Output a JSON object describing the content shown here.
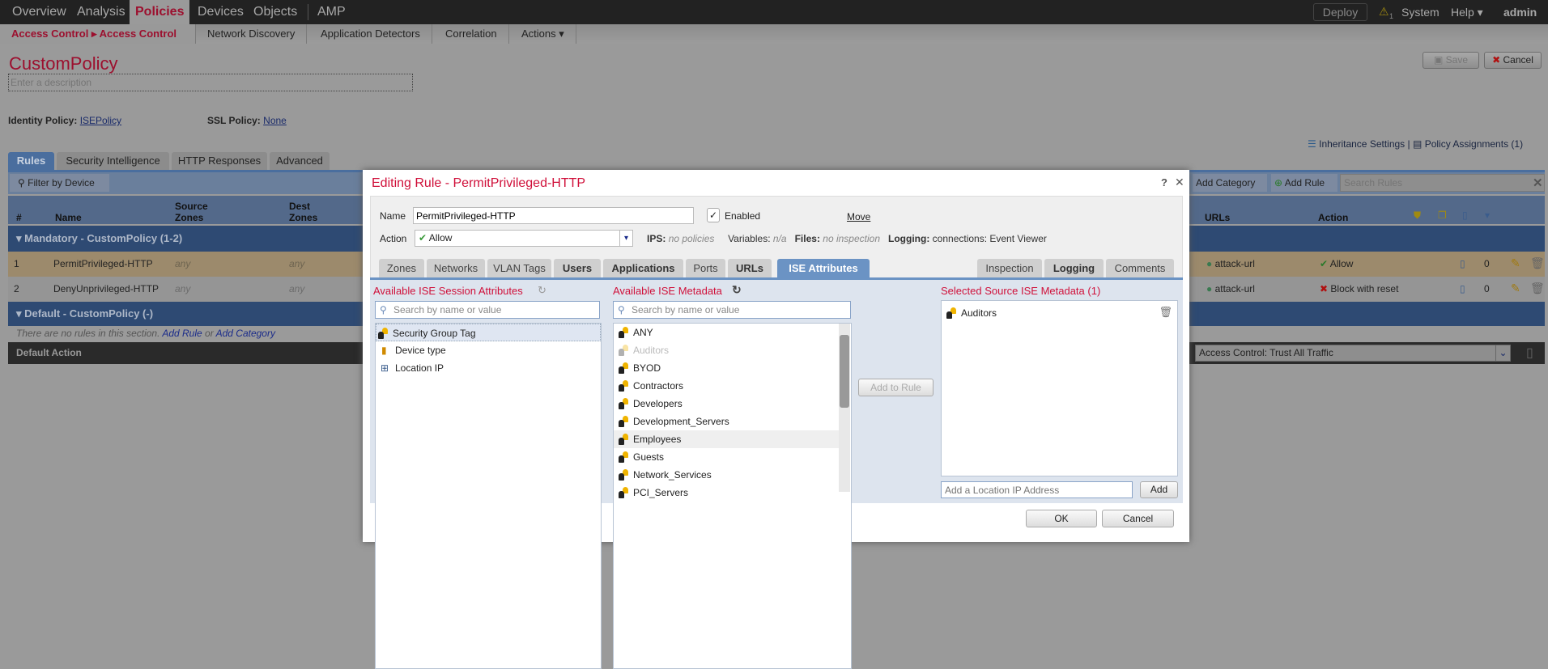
{
  "topnav": {
    "items": [
      "Overview",
      "Analysis",
      "Policies",
      "Devices",
      "Objects",
      "AMP"
    ],
    "active": "Policies",
    "deploy": "Deploy",
    "alert_count": "1",
    "system": "System",
    "help": "Help ▾",
    "user": "admin ▾"
  },
  "subnav": {
    "breadcrumb_1": "Access Control",
    "breadcrumb_2": "Access Control",
    "items": [
      "Network Discovery",
      "Application Detectors",
      "Correlation",
      "Actions ▾"
    ]
  },
  "policy": {
    "title": "CustomPolicy",
    "description_placeholder": "Enter a description",
    "identity_label": "Identity Policy:",
    "identity_value": "ISEPolicy",
    "ssl_label": "SSL Policy:",
    "ssl_value": "None",
    "save": "Save",
    "cancel": "Cancel",
    "inheritance": "Inheritance Settings",
    "separator": "|",
    "assignments": "Policy Assignments (1)"
  },
  "tabs": [
    "Rules",
    "Security Intelligence",
    "HTTP Responses",
    "Advanced"
  ],
  "toolbar": {
    "filter": "Filter by Device",
    "add_category": "Add Category",
    "add_rule": "Add Rule",
    "search_placeholder": "Search Rules"
  },
  "table": {
    "headers": {
      "num": "#",
      "name": "Name",
      "src": "Source Zones",
      "dst": "Dest Zones",
      "urls": "URLs",
      "action": "Action"
    },
    "mandatory": "Mandatory - CustomPolicy (1-2)",
    "rows": [
      {
        "num": "1",
        "name": "PermitPrivileged-HTTP",
        "src": "any",
        "dst": "any",
        "url": "attack-url",
        "action": "Allow",
        "count": "0"
      },
      {
        "num": "2",
        "name": "DenyUnprivileged-HTTP",
        "src": "any",
        "dst": "any",
        "url": "attack-url",
        "action": "Block with reset",
        "count": "0"
      }
    ],
    "default_section": "Default - CustomPolicy (-)",
    "empty_text": "There are no rules in this section.",
    "empty_add_rule": "Add Rule",
    "empty_or": "or",
    "empty_add_category": "Add Category",
    "default_action_label": "Default Action",
    "default_action_value": "Access Control: Trust All Traffic"
  },
  "dialog": {
    "title": "Editing Rule - PermitPrivileged-HTTP",
    "help": "?",
    "close": "✕",
    "name_label": "Name",
    "name_value": "PermitPrivileged-HTTP",
    "enabled": "Enabled",
    "move": "Move",
    "action_label": "Action",
    "action_value": "Allow",
    "ips_label": "IPS:",
    "ips_value": "no policies",
    "vars_label": "Variables:",
    "vars_value": "n/a",
    "files_label": "Files:",
    "files_value": "no inspection",
    "logging_label": "Logging:",
    "logging_value": "connections: Event Viewer",
    "tabs": [
      "Zones",
      "Networks",
      "VLAN Tags",
      "Users",
      "Applications",
      "Ports",
      "URLs",
      "ISE Attributes"
    ],
    "right_tabs": [
      "Inspection",
      "Logging",
      "Comments"
    ],
    "active_tab": "ISE Attributes",
    "session_title": "Available ISE Session Attributes",
    "metadata_title": "Available ISE Metadata",
    "selected_title": "Selected Source ISE Metadata (1)",
    "search_placeholder": "Search by name or value",
    "session_items": [
      "Security Group Tag",
      "Device type",
      "Location IP"
    ],
    "metadata_items": [
      "ANY",
      "Auditors",
      "BYOD",
      "Contractors",
      "Developers",
      "Development_Servers",
      "Employees",
      "Guests",
      "Network_Services",
      "PCI_Servers"
    ],
    "selected_items": [
      "Auditors"
    ],
    "add_to_rule": "Add to Rule",
    "location_placeholder": "Add a Location IP Address",
    "add": "Add",
    "ok": "OK",
    "cancel": "Cancel"
  },
  "colors": {
    "accent_red": "#d0103a",
    "tab_blue": "#6b93c4",
    "section_blue": "#2e4a73"
  }
}
